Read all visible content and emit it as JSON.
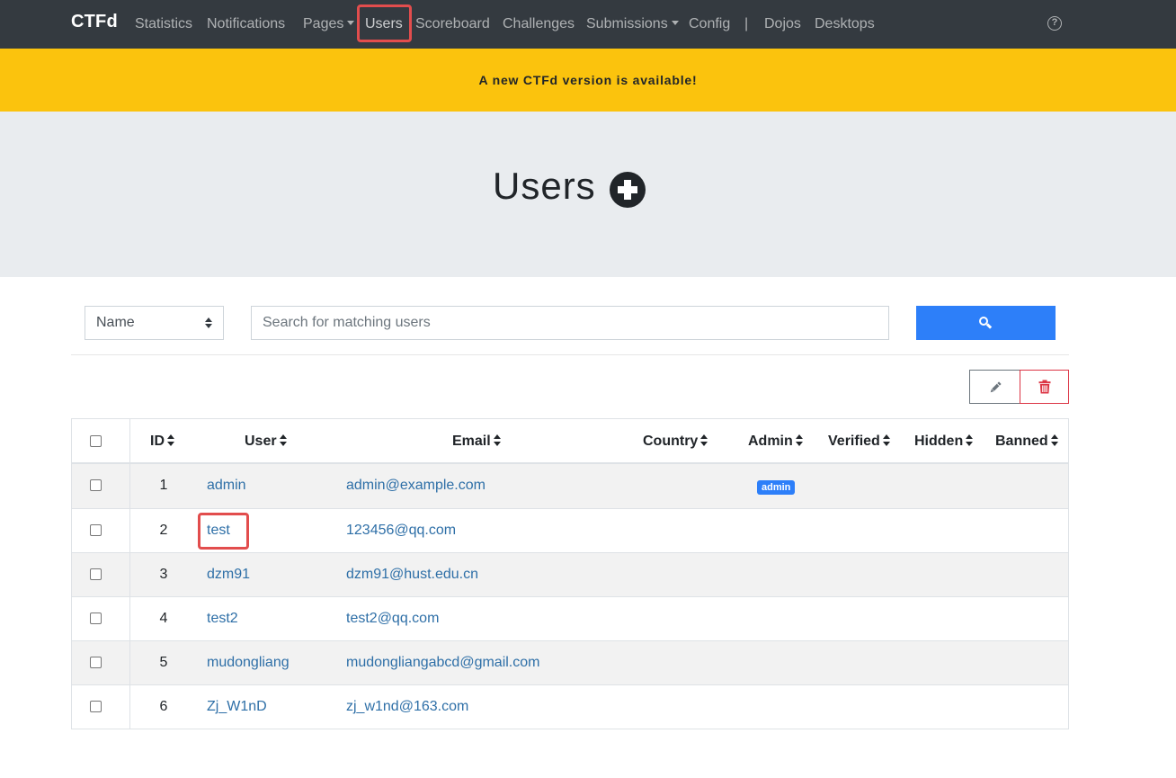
{
  "navbar": {
    "brand": "CTFd",
    "items": [
      {
        "label": "Statistics"
      },
      {
        "label": "Notifications"
      },
      {
        "label": "Pages"
      },
      {
        "label": "Users"
      },
      {
        "label": "Scoreboard"
      },
      {
        "label": "Challenges"
      },
      {
        "label": "Submissions"
      },
      {
        "label": "Config"
      },
      {
        "label": "|"
      },
      {
        "label": "Dojos"
      },
      {
        "label": "Desktops"
      }
    ],
    "help_glyph": "?",
    "active_item": "Users"
  },
  "banner": {
    "text": "A new CTFd version is available!",
    "color": "#fbc30d"
  },
  "page": {
    "title": "Users",
    "add_icon": "plus-circle-icon"
  },
  "search": {
    "field_selected": "Name",
    "placeholder": "Search for matching users",
    "button_icon": "search-icon",
    "button_color": "#2d7ff9"
  },
  "actions": {
    "edit_icon": "pencil-icon",
    "delete_icon": "trash-icon"
  },
  "table": {
    "columns": [
      "ID",
      "User",
      "Email",
      "Country",
      "Admin",
      "Verified",
      "Hidden",
      "Banned"
    ],
    "rows": [
      {
        "id": "1",
        "user": "admin",
        "email": "admin@example.com",
        "admin_badge": "admin"
      },
      {
        "id": "2",
        "user": "test",
        "email": "123456@qq.com"
      },
      {
        "id": "3",
        "user": "dzm91",
        "email": "dzm91@hust.edu.cn"
      },
      {
        "id": "4",
        "user": "test2",
        "email": "test2@qq.com"
      },
      {
        "id": "5",
        "user": "mudongliang",
        "email": "mudongliangabcd@gmail.com"
      },
      {
        "id": "6",
        "user": "Zj_W1nD",
        "email": "zj_w1nd@163.com"
      }
    ],
    "highlighted_user": "test"
  }
}
